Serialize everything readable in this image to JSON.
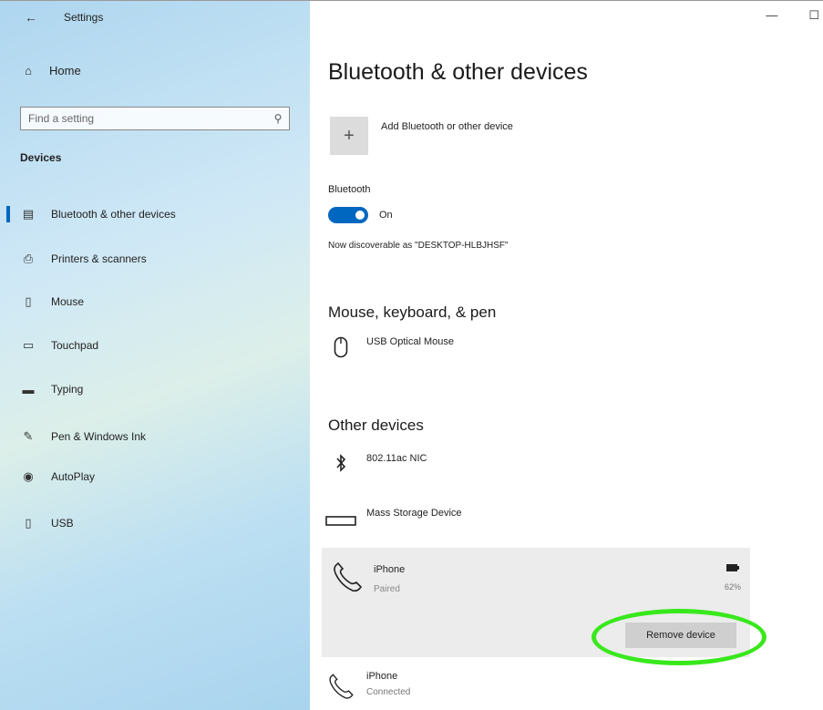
{
  "window": {
    "title": "Settings",
    "minimize_glyph": "—",
    "maximize_glyph": "☐"
  },
  "sidebar": {
    "back_glyph": "←",
    "home": {
      "label": "Home",
      "icon": "⌂"
    },
    "search": {
      "placeholder": "Find a setting",
      "icon": "⚲"
    },
    "section_label": "Devices",
    "items": [
      {
        "label": "Bluetooth & other devices",
        "icon": "▤",
        "selected": true
      },
      {
        "label": "Printers & scanners",
        "icon": "⎙",
        "selected": false
      },
      {
        "label": "Mouse",
        "icon": "▯",
        "selected": false
      },
      {
        "label": "Touchpad",
        "icon": "▭",
        "selected": false
      },
      {
        "label": "Typing",
        "icon": "▬",
        "selected": false
      },
      {
        "label": "Pen & Windows Ink",
        "icon": "✎",
        "selected": false
      },
      {
        "label": "AutoPlay",
        "icon": "◉",
        "selected": false
      },
      {
        "label": "USB",
        "icon": "▯",
        "selected": false
      }
    ]
  },
  "main": {
    "title": "Bluetooth & other devices",
    "add_device": {
      "label": "Add Bluetooth or other device",
      "icon": "+"
    },
    "bluetooth": {
      "label": "Bluetooth",
      "state": "On",
      "discoverable_text": "Now discoverable as \"DESKTOP-HLBJHSF\""
    },
    "mouse_section": {
      "heading": "Mouse, keyboard, & pen",
      "devices": [
        {
          "name": "USB Optical Mouse",
          "icon": "mouse-icon"
        }
      ]
    },
    "other_section": {
      "heading": "Other devices",
      "devices": [
        {
          "name": "802.11ac NIC",
          "icon": "bluetooth-icon"
        },
        {
          "name": "Mass Storage Device",
          "icon": "drive-icon"
        }
      ],
      "selected_device": {
        "name": "iPhone",
        "status": "Paired",
        "battery": "62%",
        "remove_label": "Remove device"
      },
      "last_device": {
        "name": "iPhone",
        "status": "Connected"
      }
    }
  },
  "colors": {
    "accent": "#0067c0",
    "highlight": "#39e81c"
  }
}
